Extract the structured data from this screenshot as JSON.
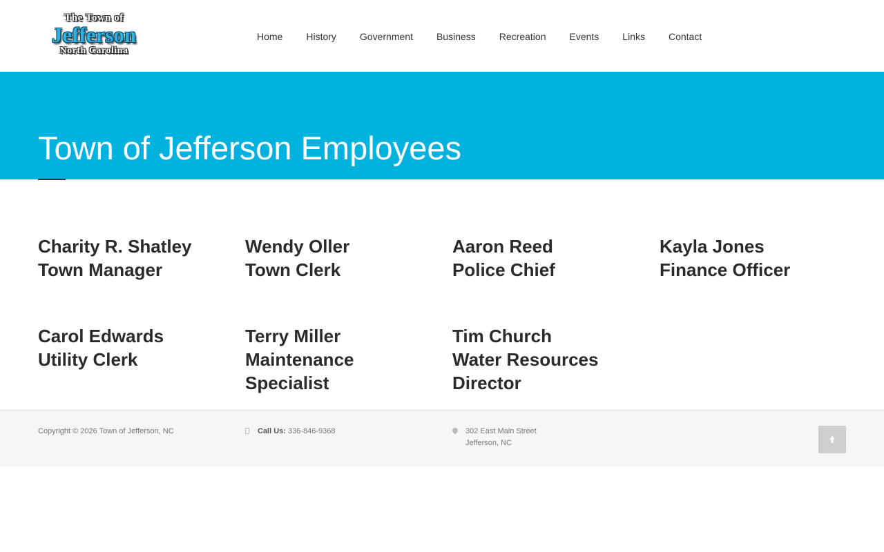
{
  "logo": {
    "line1": "The Town of",
    "line2": "Jefferson",
    "line3": "North Carolina"
  },
  "nav": [
    "Home",
    "History",
    "Government",
    "Business",
    "Recreation",
    "Events",
    "Links",
    "Contact"
  ],
  "banner": {
    "title": "Town of Jefferson Employees",
    "color": "#01b2df"
  },
  "employees": [
    {
      "name": "Charity R. Shatley",
      "title": "Town Manager"
    },
    {
      "name": "Wendy Oller",
      "title": "Town Clerk"
    },
    {
      "name": "Aaron Reed",
      "title": "Police Chief"
    },
    {
      "name": "Kayla Jones",
      "title": "Finance Officer"
    },
    {
      "name": "Carol Edwards",
      "title": "Utility Clerk"
    },
    {
      "name": "Terry Miller",
      "title": "Maintenance Specialist"
    },
    {
      "name": "Tim Church",
      "title": "Water Resources Director"
    }
  ],
  "footer": {
    "copyright": "Copyright © 2026 Town of Jefferson, NC",
    "phone_label": "Call Us:",
    "phone": "336-846-9368",
    "address_line1": "302 East Main Street",
    "address_line2": "Jefferson, NC",
    "phone_icon": "phone-icon",
    "address_icon": "map-pin-icon",
    "top_icon": "arrow-up-icon"
  }
}
